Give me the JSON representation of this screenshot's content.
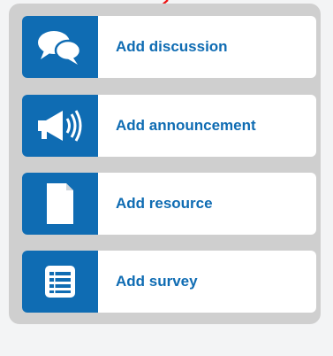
{
  "colors": {
    "accent": "#0f6cb3",
    "panel_bg": "#cfcfcf",
    "card_bg": "#ffffff",
    "annotation_arrow": "#ee1111"
  },
  "actions": [
    {
      "label": "Add discussion",
      "icon": "discussion-bubbles-icon"
    },
    {
      "label": "Add announcement",
      "icon": "megaphone-icon"
    },
    {
      "label": "Add resource",
      "icon": "document-icon"
    },
    {
      "label": "Add survey",
      "icon": "survey-list-icon"
    }
  ]
}
